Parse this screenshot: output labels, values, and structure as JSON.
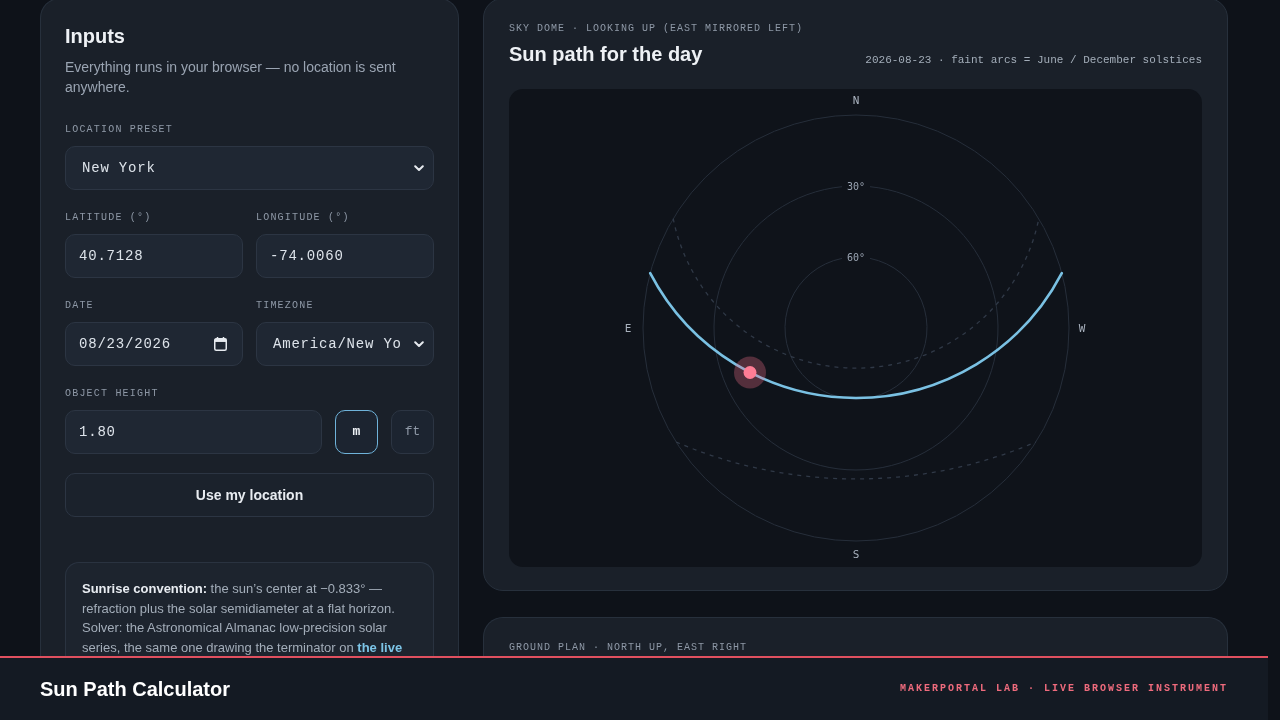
{
  "inputs_panel": {
    "title": "Inputs",
    "description": "Everything runs in your browser — no location is sent anywhere.",
    "location_preset": {
      "label": "LOCATION PRESET",
      "value": "New York"
    },
    "latitude": {
      "label": "LATITUDE (°)",
      "value": "40.7128"
    },
    "longitude": {
      "label": "LONGITUDE (°)",
      "value": "-74.0060"
    },
    "date": {
      "label": "DATE",
      "value": "08/23/2026"
    },
    "timezone": {
      "label": "TIMEZONE",
      "value": "America/New Yo"
    },
    "object_height": {
      "label": "OBJECT HEIGHT",
      "value": "1.80",
      "units": [
        {
          "label": "m",
          "selected": true
        },
        {
          "label": "ft",
          "selected": false
        }
      ]
    },
    "location_button": "Use my location",
    "note": {
      "text": "**Sunrise convention:** the sun’s center at −0.833° — refraction plus the solar semidiameter at a flat horizon. Solver: the Astronomical Almanac low-precision solar series, the same one drawing the terminator on",
      "link": "the live"
    }
  },
  "sky_dome": {
    "eyebrow": "SKY DOME · LOOKING UP (EAST MIRRORED LEFT)",
    "title": "Sun path for the day",
    "caption": "2026-08-23 · faint arcs = June / December solstices",
    "compass": {
      "north": "N",
      "east": "E",
      "south": "S",
      "west": "W"
    },
    "altitude_rings": [
      {
        "label": "30°"
      },
      {
        "label": "60°"
      }
    ]
  },
  "ground_plan": {
    "eyebrow": "GROUND PLAN · NORTH UP, EAST RIGHT"
  },
  "footer": {
    "title": "Sun Path Calculator",
    "tagline": "MAKERPORTAL LAB · LIVE BROWSER INSTRUMENT"
  }
}
